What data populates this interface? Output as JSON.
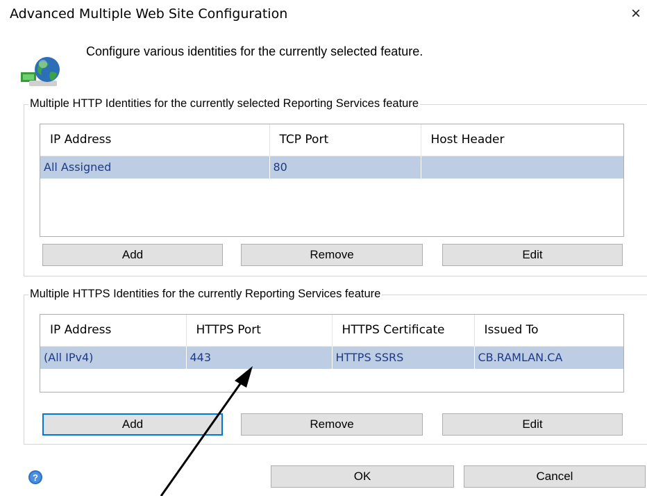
{
  "window": {
    "title": "Advanced Multiple Web Site Configuration",
    "close_glyph": "×"
  },
  "header": {
    "icon": "globe-network-icon",
    "description": "Configure various identities for the currently selected feature."
  },
  "http_group": {
    "legend": "Multiple HTTP Identities for the currently selected Reporting Services feature",
    "columns": [
      "IP Address",
      "TCP Port",
      "Host Header"
    ],
    "rows": [
      [
        "All Assigned",
        "80",
        ""
      ]
    ],
    "buttons": {
      "add": "Add",
      "remove": "Remove",
      "edit": "Edit"
    }
  },
  "https_group": {
    "legend": "Multiple HTTPS Identities for the currently Reporting Services feature",
    "columns": [
      "IP Address",
      "HTTPS Port",
      "HTTPS Certificate",
      "Issued To"
    ],
    "rows": [
      [
        "(All IPv4)",
        "443",
        "HTTPS SSRS",
        "CB.RAMLAN.CA"
      ]
    ],
    "buttons": {
      "add": "Add",
      "remove": "Remove",
      "edit": "Edit"
    }
  },
  "footer": {
    "help_icon": "help-icon",
    "ok_label": "OK",
    "cancel_label": "Cancel"
  },
  "colors": {
    "selection_row": "#bccde4",
    "selection_text": "#1f3a85",
    "focus_border": "#0078d7",
    "button_face": "#e1e1e1"
  }
}
